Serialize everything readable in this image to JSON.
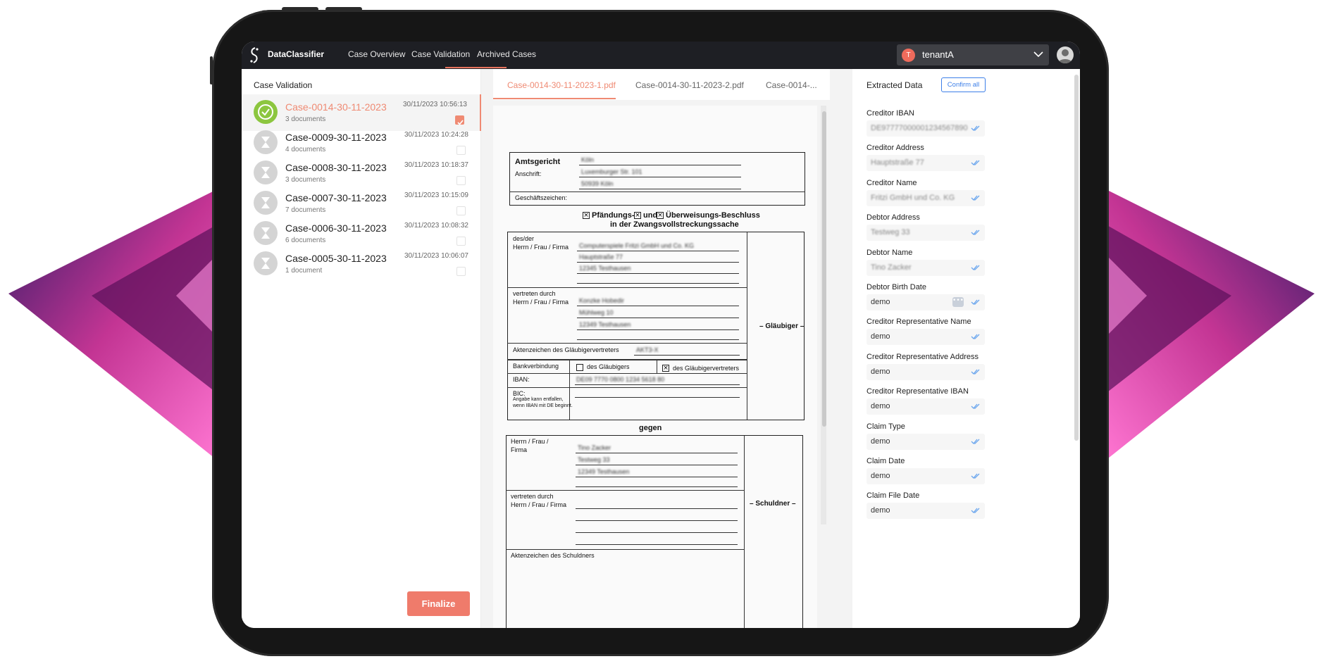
{
  "app": {
    "brand": "DataClassifier",
    "nav": [
      "Case Overview",
      "Case Validation",
      "Archived Cases"
    ],
    "active_nav": "Case Validation",
    "tenant": {
      "initial": "T",
      "name": "tenantA"
    },
    "accent_color": "#ef8a73"
  },
  "left_panel": {
    "title": "Case Validation",
    "cases": [
      {
        "name": "Case-0014-30-11-2023",
        "docs": "3 documents",
        "time": "30/11/2023 10:56:13",
        "status": "validated",
        "checked": true,
        "selected": true
      },
      {
        "name": "Case-0009-30-11-2023",
        "docs": "4 documents",
        "time": "30/11/2023 10:24:28",
        "status": "pending",
        "checked": false,
        "selected": false
      },
      {
        "name": "Case-0008-30-11-2023",
        "docs": "3 documents",
        "time": "30/11/2023 10:18:37",
        "status": "pending",
        "checked": false,
        "selected": false
      },
      {
        "name": "Case-0007-30-11-2023",
        "docs": "7 documents",
        "time": "30/11/2023 10:15:09",
        "status": "pending",
        "checked": false,
        "selected": false
      },
      {
        "name": "Case-0006-30-11-2023",
        "docs": "6 documents",
        "time": "30/11/2023 10:08:32",
        "status": "pending",
        "checked": false,
        "selected": false
      },
      {
        "name": "Case-0005-30-11-2023",
        "docs": "1 document",
        "time": "30/11/2023 10:06:07",
        "status": "pending",
        "checked": false,
        "selected": false
      }
    ],
    "finalize_label": "Finalize"
  },
  "viewer": {
    "tabs": [
      "Case-0014-30-11-2023-1.pdf",
      "Case-0014-30-11-2023-2.pdf",
      "Case-0014-..."
    ],
    "active_tab": 0,
    "document": {
      "court_label": "Amtsgericht",
      "court_value": "Köln",
      "address_label": "Anschrift:",
      "address_line1": "Luxemburger Str. 101",
      "address_line2": "50939 Köln",
      "reference_label": "Geschäftszeichen:",
      "heading_line1_a": "Pfändungs-",
      "heading_line1_b": "und",
      "heading_line1_c": "Überweisungs-Beschluss",
      "heading_line2": "in der Zwangsvollstreckungssache",
      "creditor_intro": "des/der",
      "creditor_herr": "Herrn / Frau / Firma",
      "creditor_name": "Computerspiele Fritzi GmbH und Co. KG",
      "creditor_street": "Hauptstraße 77",
      "creditor_city": "12345 Testhausen",
      "rep_intro": "vertreten durch",
      "rep_herr": "Herrn / Frau / Firma",
      "rep_name": "Konzke Hobedir",
      "rep_street": "Mühlweg 10",
      "rep_city": "12349 Testhausen",
      "rep_ref_label": "Aktenzeichen des Gläubigervertreters",
      "rep_ref_value": "AKT3-X",
      "bank_label": "Bankverbindung",
      "bank_opt1": "des Gläubigers",
      "bank_opt2": "des Gläubigervertreters",
      "iban_label": "IBAN:",
      "iban_value": "DE09 7770 0800 1234 5618 80",
      "bic_label": "BIC:",
      "bic_note1": "Angabe kann entfallen,",
      "bic_note2": "wenn IBAN mit DE beginnt.",
      "side_creditor": "– Gläubiger –",
      "against": "gegen",
      "debtor_herr1": "Herrn / Frau /",
      "debtor_herr2": "Firma",
      "debtor_name": "Tino Zacker",
      "debtor_street": "Testweg 33",
      "debtor_city": "12349 Testhausen",
      "debtor_rep_intro": "vertreten durch",
      "debtor_rep_herr": "Herrn / Frau / Firma",
      "side_debtor": "– Schuldner –",
      "debtor_ref_label": "Aktenzeichen des Schuldners"
    }
  },
  "right_panel": {
    "title": "Extracted Data",
    "confirm_all_label": "Confirm all",
    "fields": [
      {
        "label": "Creditor IBAN",
        "value": "DE97777000001234567890",
        "blurred": true,
        "has_menu": false
      },
      {
        "label": "Creditor Address",
        "value": "Hauptstraße 77",
        "blurred": true,
        "has_menu": false
      },
      {
        "label": "Creditor Name",
        "value": "Fritzi GmbH und Co. KG",
        "blurred": true,
        "has_menu": false
      },
      {
        "label": "Debtor Address",
        "value": "Testweg 33",
        "blurred": true,
        "has_menu": false
      },
      {
        "label": "Debtor Name",
        "value": "Tino Zacker",
        "blurred": true,
        "has_menu": false
      },
      {
        "label": "Debtor Birth Date",
        "value": "demo",
        "blurred": false,
        "has_menu": true
      },
      {
        "label": "Creditor Representative Name",
        "value": "demo",
        "blurred": false,
        "has_menu": false
      },
      {
        "label": "Creditor Representative Address",
        "value": "demo",
        "blurred": false,
        "has_menu": false
      },
      {
        "label": "Creditor Representative IBAN",
        "value": "demo",
        "blurred": false,
        "has_menu": false
      },
      {
        "label": "Claim Type",
        "value": "demo",
        "blurred": false,
        "has_menu": false
      },
      {
        "label": "Claim Date",
        "value": "demo",
        "blurred": false,
        "has_menu": false
      },
      {
        "label": "Claim File Date",
        "value": "demo",
        "blurred": false,
        "has_menu": false
      }
    ]
  }
}
